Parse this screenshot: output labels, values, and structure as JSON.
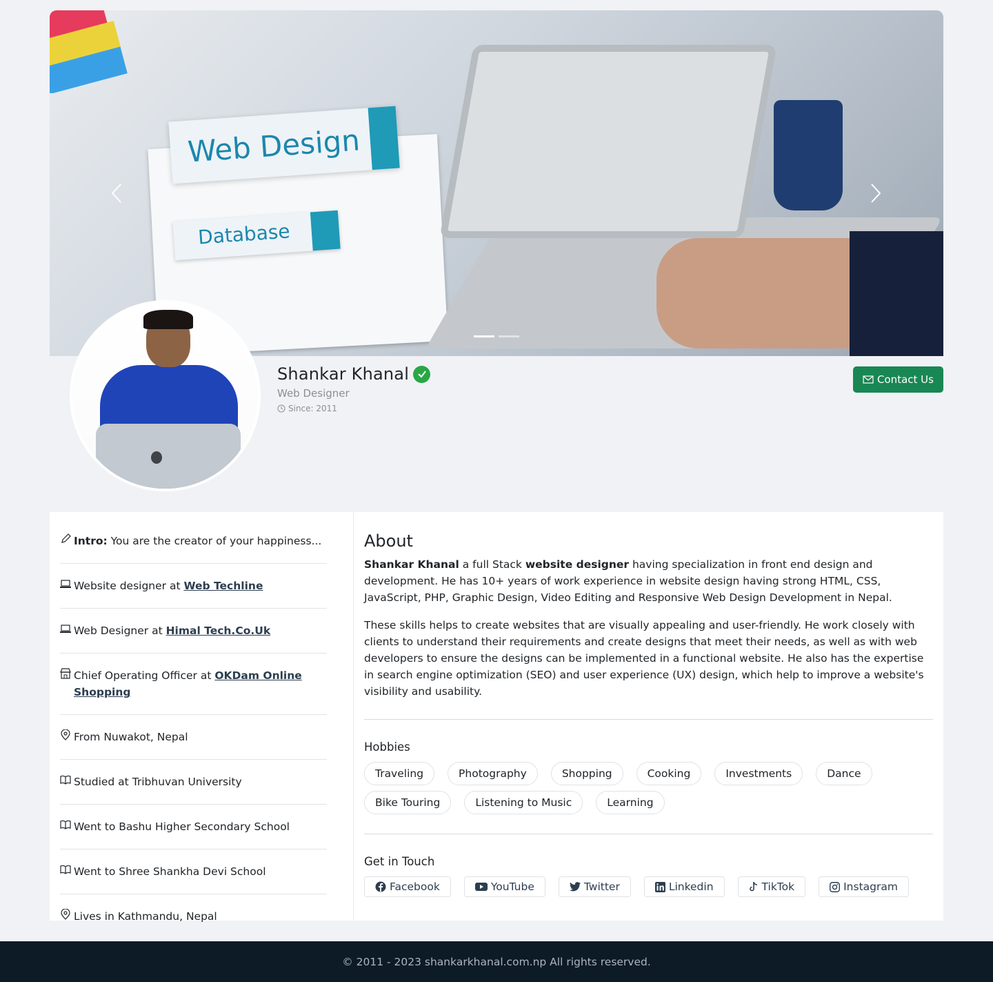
{
  "hero": {
    "prev_icon": "chevron-left-icon",
    "next_icon": "chevron-right-icon",
    "card_text_1": "Web Design",
    "card_text_2": "Database",
    "slide_count": 2,
    "active_slide": 1
  },
  "profile": {
    "name": "Shankar Khanal",
    "role": "Web Designer",
    "since": "Since: 2011",
    "contact_label": "Contact Us",
    "accent": "#198754",
    "verified_color": "#28a745"
  },
  "info": [
    {
      "icon": "pencil-icon",
      "label": "Intro:",
      "text": " You are the creator of your happiness..."
    },
    {
      "icon": "laptop-icon",
      "text": "Website designer at ",
      "link": "Web Techline"
    },
    {
      "icon": "laptop-icon",
      "text": "Web Designer at ",
      "link": "Himal Tech.Co.Uk"
    },
    {
      "icon": "shop-icon",
      "text": "Chief Operating Officer at ",
      "link": "OKDam Online Shopping"
    },
    {
      "icon": "geo-pin-icon",
      "text": "From Nuwakot, Nepal"
    },
    {
      "icon": "book-icon",
      "text": "Studied at Tribhuvan University"
    },
    {
      "icon": "book-icon",
      "text": "Went to Bashu Higher Secondary School"
    },
    {
      "icon": "book-icon",
      "text": "Went to Shree Shankha Devi School"
    },
    {
      "icon": "geo-pin-icon",
      "text": "Lives in Kathmandu, Nepal"
    }
  ],
  "about": {
    "title": "About",
    "p1_name": "Shankar Khanal",
    "p1_mid": " a full Stack ",
    "p1_role": "website designer",
    "p1_rest": " having specialization in front end design and development. He has 10+ years of work experience in website design having strong HTML, CSS, JavaScript, PHP, Graphic Design, Video Editing and Responsive Web Design Development in Nepal.",
    "p2": "These skills helps to create websites that are visually appealing and user-friendly. He work closely with clients to understand their requirements and create designs that meet their needs, as well as with web developers to ensure the designs can be implemented in a functional website. He also has the expertise in search engine optimization (SEO) and user experience (UX) design, which help to improve a website's visibility and usability."
  },
  "hobbies": {
    "title": "Hobbies",
    "items": [
      "Traveling",
      "Photography",
      "Shopping",
      "Cooking",
      "Investments",
      "Dance",
      "Bike Touring",
      "Listening to Music",
      "Learning"
    ]
  },
  "contact": {
    "title": "Get in Touch",
    "links": [
      {
        "icon": "facebook-icon",
        "label": "Facebook"
      },
      {
        "icon": "youtube-icon",
        "label": "YouTube"
      },
      {
        "icon": "twitter-icon",
        "label": "Twitter"
      },
      {
        "icon": "linkedin-icon",
        "label": "Linkedin"
      },
      {
        "icon": "tiktok-icon",
        "label": "TikTok"
      },
      {
        "icon": "instagram-icon",
        "label": "Instagram"
      }
    ]
  },
  "footer": {
    "text": "© 2011 - 2023 shankarkhanal.com.np All rights reserved."
  }
}
